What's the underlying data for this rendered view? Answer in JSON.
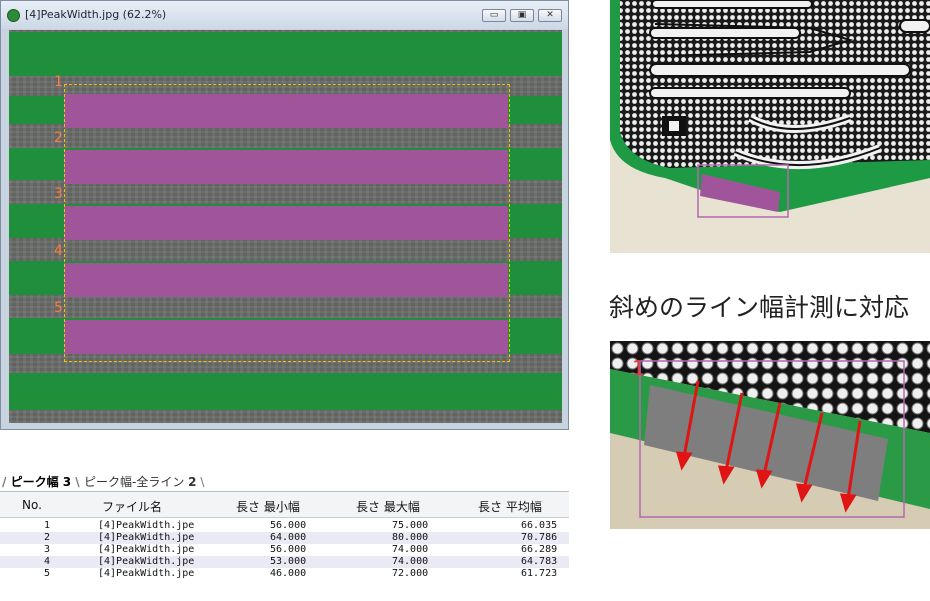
{
  "window": {
    "title": "[4]PeakWidth.jpg (62.2%)",
    "buttons": {
      "minimize": "▭",
      "maximize": "▣",
      "close": "✕"
    }
  },
  "image": {
    "line_numbers": [
      "1",
      "2",
      "3",
      "4",
      "5"
    ],
    "colors": {
      "green_band": "#1f8f3b",
      "purple_band": "#a0559b",
      "roi_border": "#f0c400",
      "line_number": "#ff7a3d"
    }
  },
  "tabs": [
    {
      "label": "ピーク幅",
      "count": "3"
    },
    {
      "label": "ピーク幅-全ライン",
      "count": "2"
    }
  ],
  "table": {
    "headers": [
      "No.",
      "ファイル名",
      "長さ 最小幅",
      "長さ 最大幅",
      "長さ 平均幅"
    ],
    "rows": [
      [
        "1",
        "[4]PeakWidth.jpe",
        "56.000",
        "75.000",
        "66.035"
      ],
      [
        "2",
        "[4]PeakWidth.jpe",
        "64.000",
        "80.000",
        "70.786"
      ],
      [
        "3",
        "[4]PeakWidth.jpe",
        "56.000",
        "74.000",
        "66.289"
      ],
      [
        "4",
        "[4]PeakWidth.jpe",
        "53.000",
        "74.000",
        "64.783"
      ],
      [
        "5",
        "[4]PeakWidth.jpe",
        "46.000",
        "72.000",
        "61.723"
      ]
    ]
  },
  "caption": "斜めのライン幅計測に対応",
  "inset_label": "1"
}
